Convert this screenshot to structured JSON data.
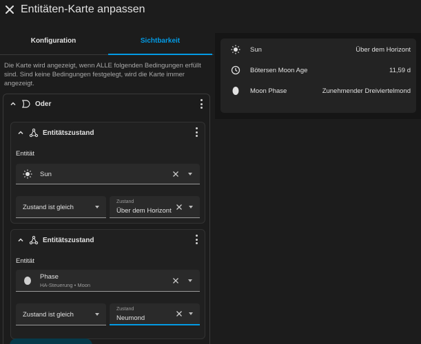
{
  "header": {
    "title": "Entitäten-Karte anpassen"
  },
  "tabs": [
    {
      "label": "Konfiguration"
    },
    {
      "label": "Sichtbarkeit"
    }
  ],
  "info_text": "Die Karte wird angezeigt, wenn ALLE folgenden Bedingungen erfüllt sind. Sind keine Bedingungen festgelegt, wird die Karte immer angezeigt.",
  "or_card": {
    "title": "Oder"
  },
  "conditions": [
    {
      "title": "Entitätszustand",
      "entity_label": "Entität",
      "entity": {
        "name": "Sun",
        "icon": "sun-icon"
      },
      "operator": "Zustand ist gleich",
      "state_label": "Zustand",
      "state_value": "Über dem Horizont"
    },
    {
      "title": "Entitätszustand",
      "entity_label": "Entität",
      "entity": {
        "name": "Phase",
        "sub": "HA-Steuerung",
        "sub2": "Moon",
        "icon": "moon-phase-icon"
      },
      "operator": "Zustand ist gleich",
      "state_label": "Zustand",
      "state_value": "Neumond"
    }
  ],
  "preview": {
    "rows": [
      {
        "name": "Sun",
        "state": "Über dem Horizont",
        "icon": "sun-icon"
      },
      {
        "name": "Bötersen Moon Age",
        "state": "11,59 d",
        "icon": "clock-icon"
      },
      {
        "name": "Moon Phase",
        "state": "Zunehmender Dreiviertelmond",
        "icon": "moon-phase-icon"
      }
    ]
  },
  "colors": {
    "accent": "#039be5",
    "background": "#1c1c1c",
    "card": "#232323"
  }
}
